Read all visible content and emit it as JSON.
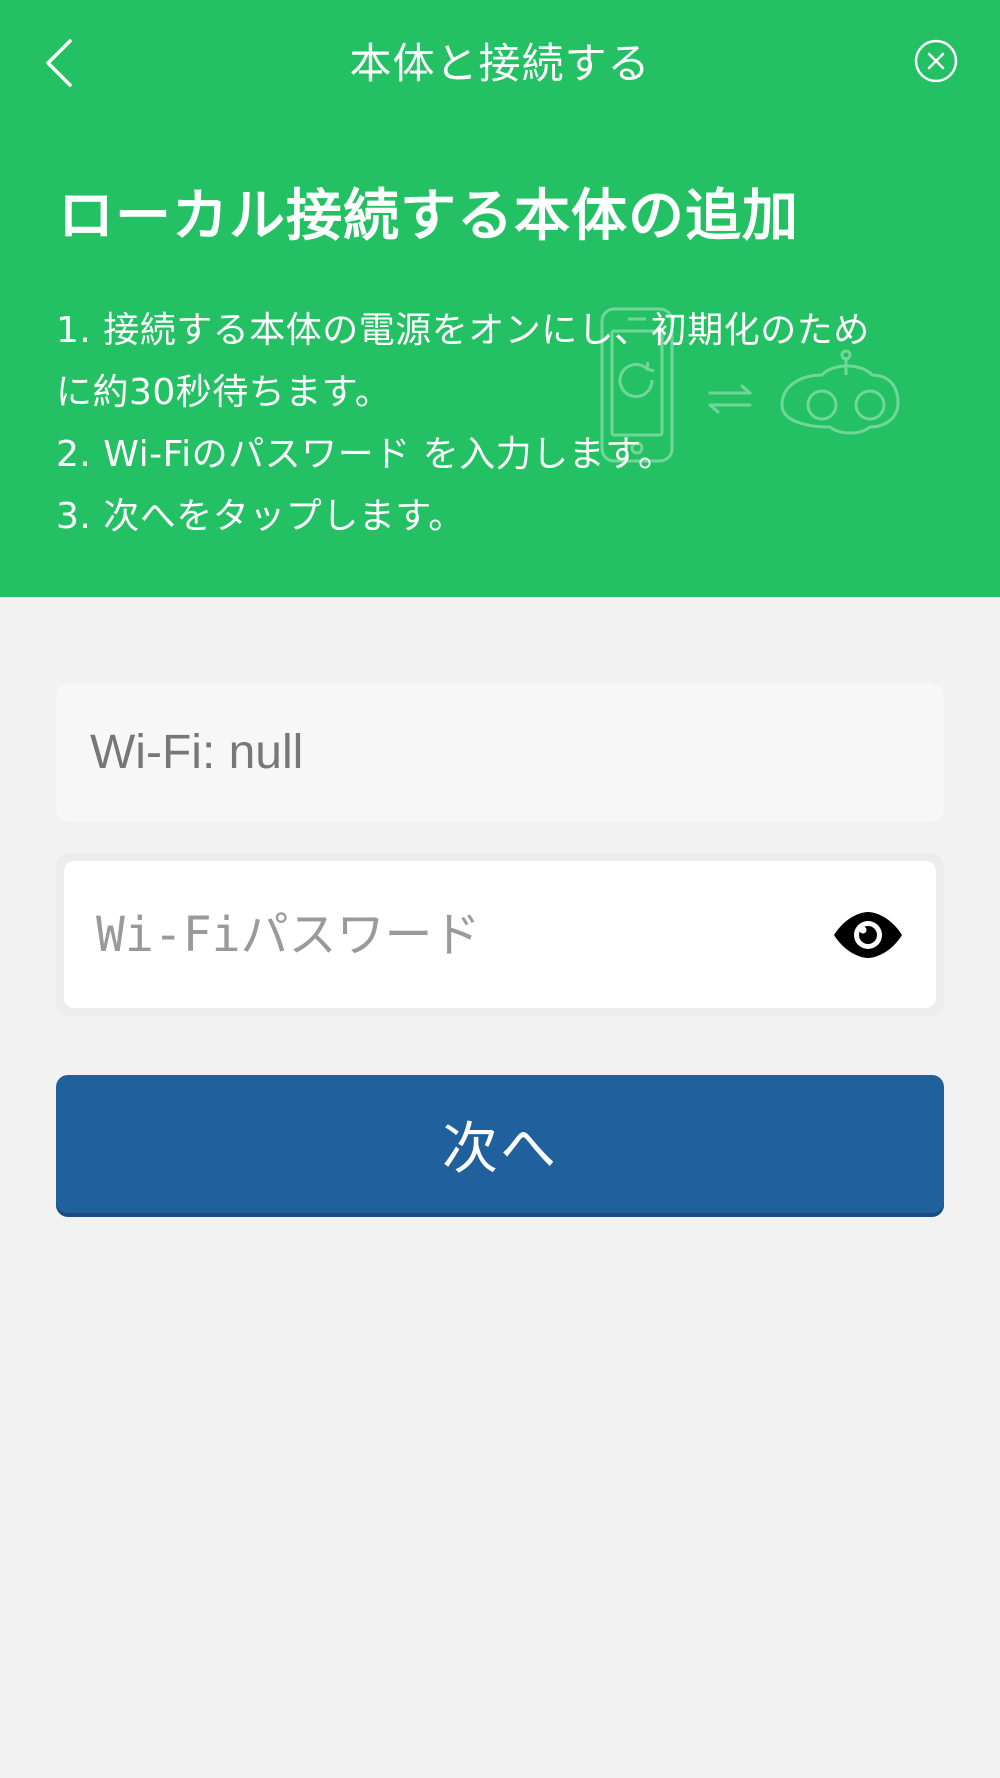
{
  "header": {
    "title": "本体と接続する",
    "back_icon": "chevron-left-icon",
    "close_icon": "close-circle-icon"
  },
  "hero": {
    "title": "ローカル接続する本体の追加",
    "steps": [
      "1. 接続する本体の電源をオンにし、初期化のため",
      "に約30秒待ちます。",
      "2. Wi-Fiのパスワード を入力します。",
      "3. 次へをタップします。"
    ],
    "illustration_icons": [
      "phone-refresh-icon",
      "transfer-arrows-icon",
      "robot-vacuum-icon"
    ]
  },
  "form": {
    "ssid_text": "Wi-Fi: null",
    "password_value": "",
    "password_placeholder": "Wi-Fiパスワード",
    "eye_icon": "eye-icon",
    "next_label": "次へ"
  },
  "colors": {
    "accent_green": "#23c163",
    "button_blue": "#20609d",
    "background": "#f2f2f2"
  }
}
